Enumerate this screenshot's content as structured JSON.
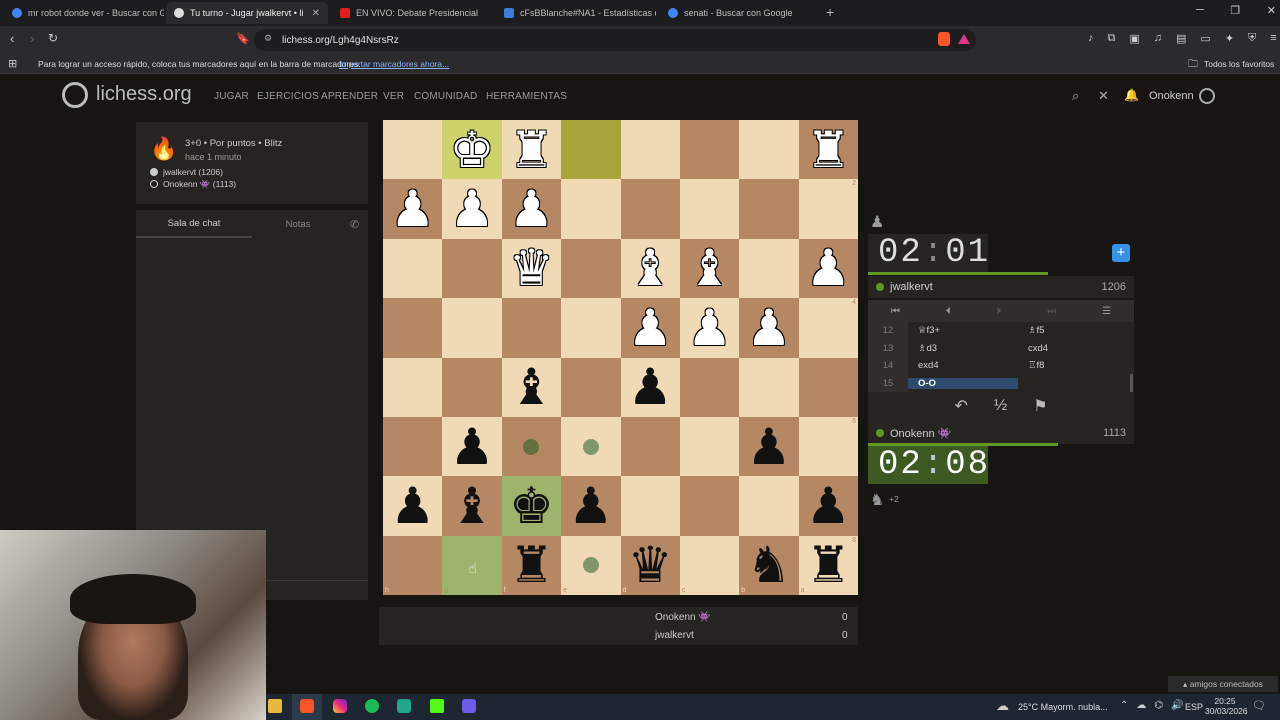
{
  "browser": {
    "tabs": [
      {
        "title": "mr robot donde ver - Buscar con Go",
        "active": false
      },
      {
        "title": "Tu turno - Jugar jwalkervt • li",
        "active": true
      },
      {
        "title": "EN VIVO: Debate Presidencial",
        "active": false
      },
      {
        "title": "cFsBBlanche#NA1 - Estadísticas del",
        "active": false
      },
      {
        "title": "senati - Buscar con Google",
        "active": false
      }
    ],
    "new_tab": "+",
    "url": "lichess.org/Lgh4g4NsrsRz",
    "bookmarks_prompt": "Para lograr un acceso rápido, coloca tus marcadores aquí en la barra de marcadores.",
    "bookmarks_import": "Importar marcadores ahora...",
    "all_favorites": "Todos los favoritos"
  },
  "lichess": {
    "logo": "lichess.org",
    "nav": [
      "JUGAR",
      "EJERCICIOS",
      "APRENDER",
      "VER",
      "COMUNIDAD",
      "HERRAMIENTAS"
    ],
    "username": "Onokenn"
  },
  "game_info": {
    "mode": "3+0 • Por puntos • Blitz",
    "time_ago": "hace 1 minuto",
    "white_player": "jwalkervt (1206)",
    "black_player": "Onokenn 👾 (1113)"
  },
  "chat": {
    "tab_chat": "Sala de chat",
    "tab_notes": "Notas"
  },
  "board": {
    "ranks": [
      "1",
      "2",
      "3",
      "4",
      "5",
      "6",
      "7",
      "8"
    ],
    "files": [
      "h",
      "g",
      "f",
      "e",
      "d",
      "c",
      "b",
      "a"
    ]
  },
  "opponent": {
    "clock_min": "02",
    "clock_sec": "01",
    "name": "jwalkervt",
    "rating": "1206"
  },
  "player": {
    "clock_min": "02",
    "clock_sec": "08",
    "name": "Onokenn 👾",
    "rating": "1113",
    "material": "+2"
  },
  "moves": [
    {
      "n": "12",
      "w": "♕f3+",
      "b": "♗f5"
    },
    {
      "n": "13",
      "w": "♗d3",
      "b": "cxd4"
    },
    {
      "n": "14",
      "w": "exd4",
      "b": "♖f8"
    },
    {
      "n": "15",
      "w": "O-O",
      "b": ""
    }
  ],
  "score": {
    "p1": "Onokenn 👾",
    "s1": "0",
    "p2": "jwalkervt",
    "s2": "0"
  },
  "taskbar": {
    "weather": "25°C  Mayorm. nubla...",
    "lang": "ESP",
    "time": "20:25",
    "date": "30/03/2026",
    "friends": "amigos conectados"
  },
  "colors": {
    "light_square": "#f0d9b5",
    "dark_square": "#b58863",
    "active_clock": "#3c5a22",
    "online": "#629924"
  }
}
